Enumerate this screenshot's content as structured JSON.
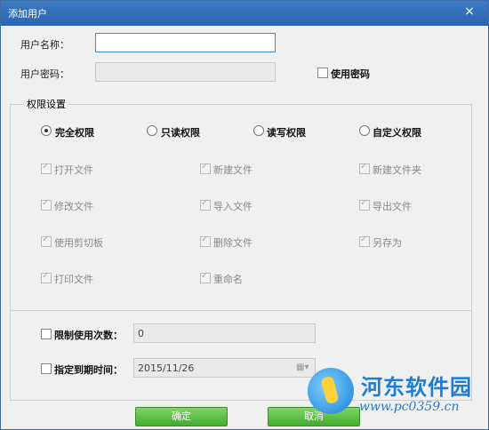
{
  "window": {
    "title": "添加用户",
    "close_glyph": "×"
  },
  "user": {
    "name_label": "用户名称：",
    "name_value": "",
    "password_label": "用户密码：",
    "password_value": "",
    "use_password_label": "使用密码",
    "use_password_checked": false
  },
  "permissions": {
    "group_title": "权限设置",
    "modes": [
      {
        "label": "完全权限",
        "selected": true
      },
      {
        "label": "只读权限",
        "selected": false
      },
      {
        "label": "读写权限",
        "selected": false
      },
      {
        "label": "自定义权限",
        "selected": false
      }
    ],
    "items": [
      {
        "label": "打开文件",
        "checked": true
      },
      {
        "label": "新建文件",
        "checked": true
      },
      {
        "label": "新建文件夹",
        "checked": true
      },
      {
        "label": "修改文件",
        "checked": true
      },
      {
        "label": "导入文件",
        "checked": true
      },
      {
        "label": "导出文件",
        "checked": true
      },
      {
        "label": "使用剪切板",
        "checked": true
      },
      {
        "label": "删除文件",
        "checked": true
      },
      {
        "label": "另存为",
        "checked": true
      },
      {
        "label": "打印文件",
        "checked": true
      },
      {
        "label": "重命名",
        "checked": true
      }
    ]
  },
  "limits": {
    "use_count_label": "限制使用次数：",
    "use_count_value": "0",
    "expiry_label": "指定到期时间：",
    "expiry_value": "2015/11/26"
  },
  "buttons": {
    "ok": "确定",
    "cancel": "取消"
  },
  "watermark": {
    "name": "河东软件园",
    "url": "www.pc0359.cn"
  },
  "colors": {
    "title_bar": "#2f6db8",
    "button_green": "#52bd3a",
    "watermark_blue": "#1e7bd6"
  }
}
